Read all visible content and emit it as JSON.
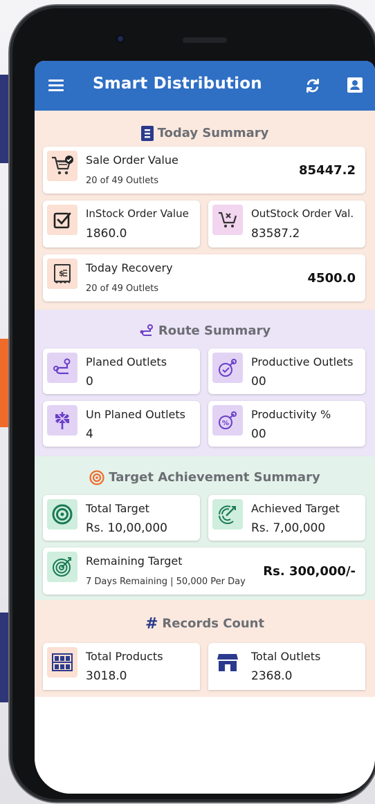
{
  "app": {
    "title": "Smart Distribution"
  },
  "today": {
    "heading": "Today Summary",
    "sale_order": {
      "label": "Sale Order Value",
      "sub": "20 of 49 Outlets",
      "value": "85447.2"
    },
    "instock": {
      "label": "InStock Order Value",
      "value": "1860.0"
    },
    "outstock": {
      "label": "OutStock Order Val.",
      "value": "83587.2"
    },
    "recovery": {
      "label": "Today Recovery",
      "sub": "20 of 49 Outlets",
      "value": "4500.0"
    }
  },
  "route": {
    "heading": "Route Summary",
    "planned": {
      "label": "Planed Outlets",
      "value": "0"
    },
    "productive": {
      "label": "Productive Outlets",
      "value": "00"
    },
    "unplanned": {
      "label": "Un Planed Outlets",
      "value": "4"
    },
    "productivity": {
      "label": "Productivity %",
      "value": "00"
    }
  },
  "target": {
    "heading": "Target Achievement Summary",
    "total": {
      "label": "Total Target",
      "value": "Rs. 10,00,000"
    },
    "achieved": {
      "label": "Achieved Target",
      "value": "Rs. 7,00,000"
    },
    "remaining": {
      "label": "Remaining Target",
      "sub": "7 Days Remaining | 50,000 Per Day",
      "value": "Rs. 300,000/-"
    }
  },
  "records": {
    "heading": "Records Count",
    "products": {
      "label": "Total Products",
      "value": "3018.0"
    },
    "outlets": {
      "label": "Total Outlets",
      "value": "2368.0"
    }
  },
  "colors": {
    "appbar": "#2f6fc4",
    "today_bg": "#fbe9df",
    "route_bg": "#ece4f7",
    "target_bg": "#e3f2ea",
    "accent_purple": "#6a3fc9",
    "accent_green": "#1b7a55",
    "accent_orange": "#ef6b2a"
  }
}
